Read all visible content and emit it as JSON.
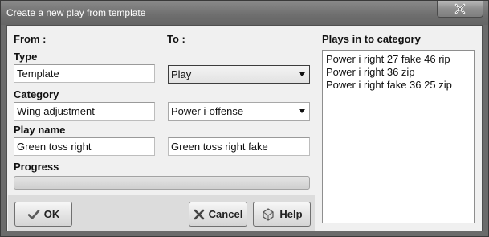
{
  "window": {
    "title": "Create a new play from template",
    "close_icon": "close-icon"
  },
  "form": {
    "from_header": "From :",
    "to_header": "To :",
    "type_label": "Type",
    "type_from_value": "Template",
    "type_to_selected": "Play",
    "category_label": "Category",
    "category_from_value": "Wing adjustment",
    "category_to_selected": "Power i-offense",
    "play_name_label": "Play name",
    "play_name_from_value": "Green toss right",
    "play_name_to_value": "Green toss right fake",
    "progress_label": "Progress",
    "progress_value": 0
  },
  "plays_panel": {
    "header": "Plays in to category",
    "items": [
      "Power i right 27 fake 46 rip",
      "Power i right 36 zip",
      "Power i right fake 36 25 zip"
    ]
  },
  "buttons": {
    "ok_label": "OK",
    "ok_icon": "check-icon",
    "cancel_label": "Cancel",
    "cancel_icon": "x-icon",
    "help_label_underlined": "H",
    "help_label_rest": "elp",
    "help_icon": "help-icon"
  }
}
